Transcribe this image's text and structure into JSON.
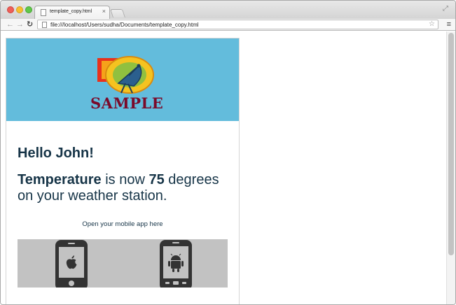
{
  "browser": {
    "tab_title": "template_copy.html",
    "tab_close": "×",
    "url": "file:///localhost/Users/sudha/Documents/template_copy.html",
    "icons": [
      "page-icon",
      "back-icon",
      "forward-icon",
      "reload-icon",
      "star-icon",
      "menu-icon",
      "fullscreen-icon"
    ]
  },
  "email": {
    "logo_text": "SAMPLE",
    "greeting": "Hello John!",
    "temperature_label": "Temperature",
    "temperature_mid": " is now ",
    "temperature_value": "75",
    "temperature_tail": " degrees on your weather station.",
    "app_link": "Open your mobile app here",
    "colors": {
      "header_band": "#63bcdc",
      "text": "#163447",
      "logo_text": "#7a0a2a",
      "app_band": "#c2c2c2",
      "phone": "#333333"
    }
  }
}
